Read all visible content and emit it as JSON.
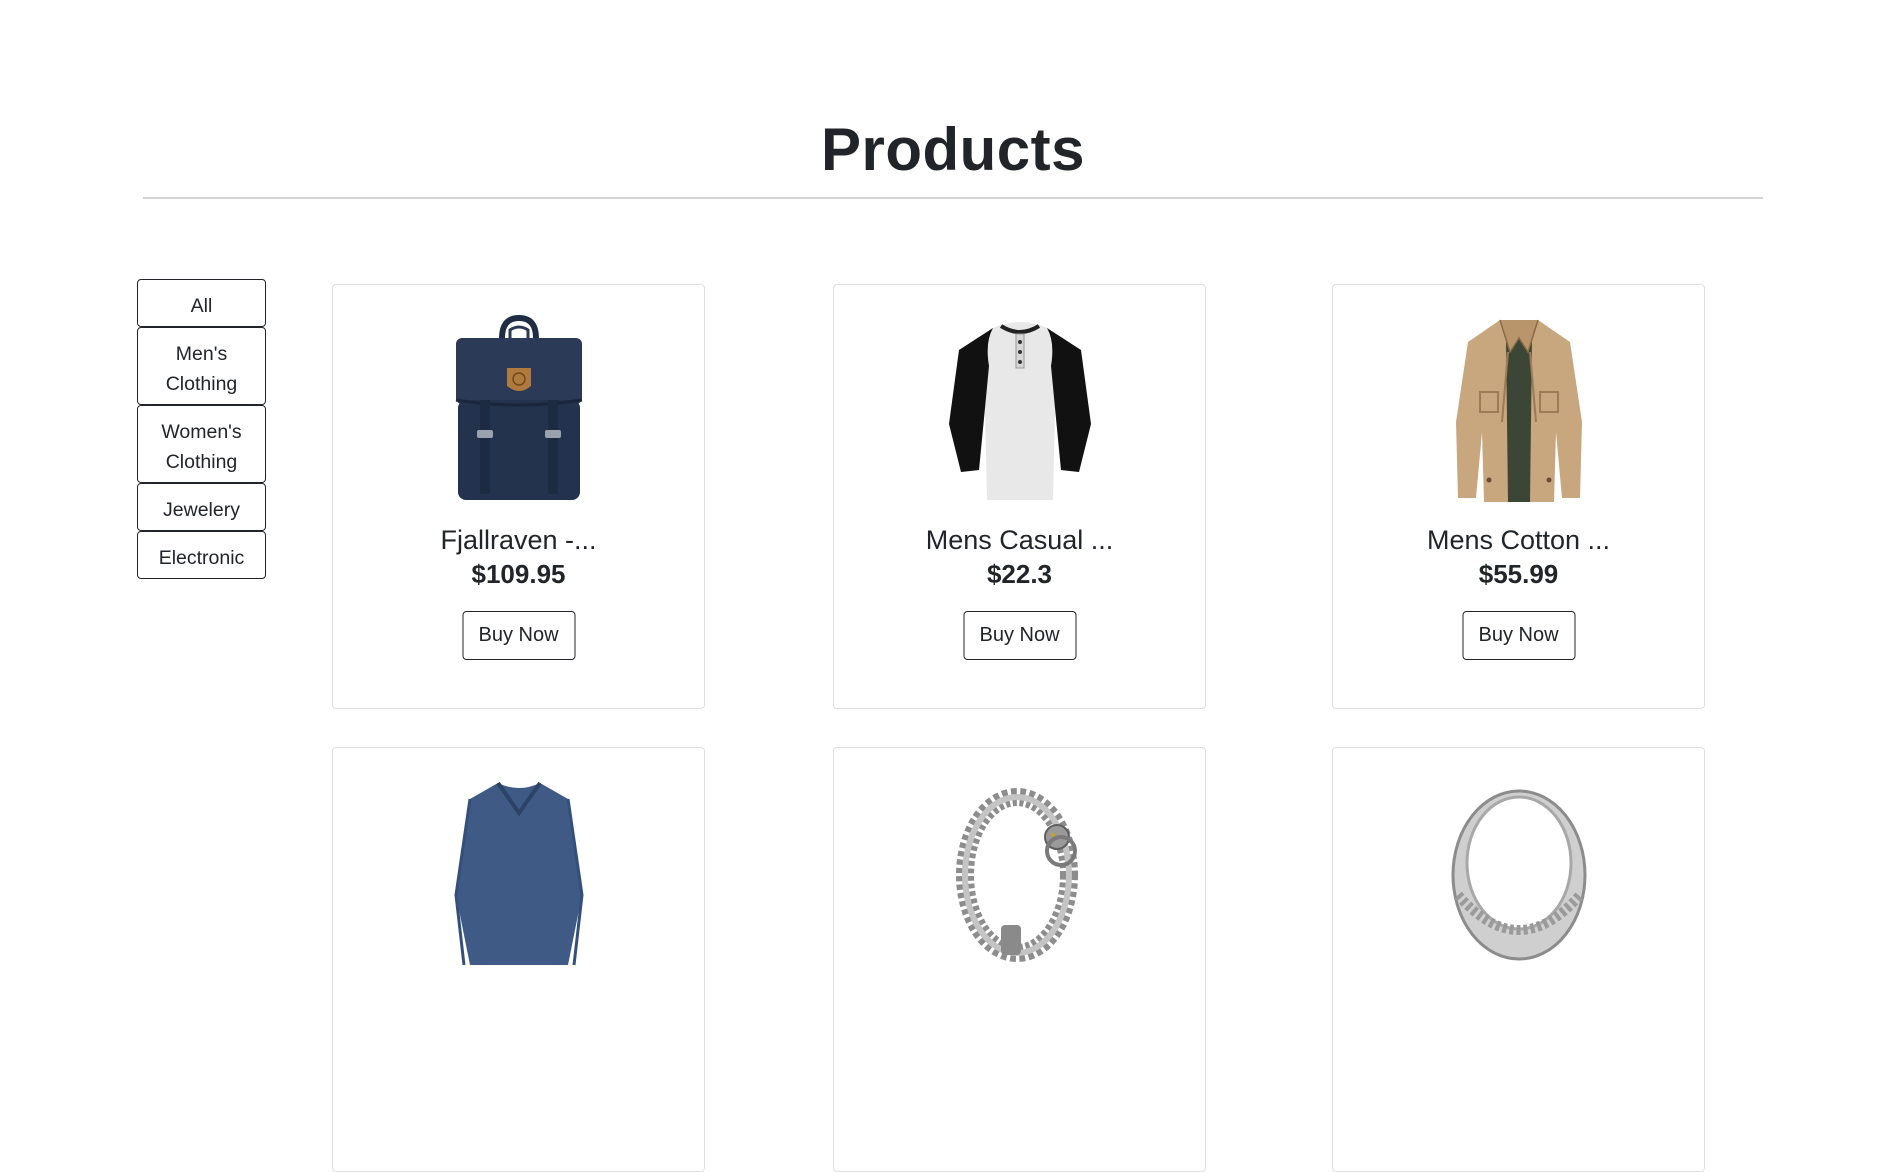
{
  "page": {
    "title": "Products"
  },
  "filters": [
    "All",
    "Men's Clothing",
    "Women's Clothing",
    "Jewelery",
    "Electronic"
  ],
  "products": [
    {
      "name": "Fjallraven -...",
      "price": "$109.95",
      "button": "Buy Now",
      "image": "backpack"
    },
    {
      "name": "Mens Casual ...",
      "price": "$22.3",
      "button": "Buy Now",
      "image": "raglan-t-shirt"
    },
    {
      "name": "Mens Cotton ...",
      "price": "$55.99",
      "button": "Buy Now",
      "image": "cotton-jacket"
    },
    {
      "name": "",
      "price": "",
      "button": "",
      "image": "long-sleeve-shirt"
    },
    {
      "name": "",
      "price": "",
      "button": "",
      "image": "dragon-bracelet"
    },
    {
      "name": "",
      "price": "",
      "button": "",
      "image": "silver-ring"
    }
  ],
  "colors": {
    "text": "#212529",
    "card_border": "#dfdfdf",
    "rule": "#d4d4d4"
  }
}
